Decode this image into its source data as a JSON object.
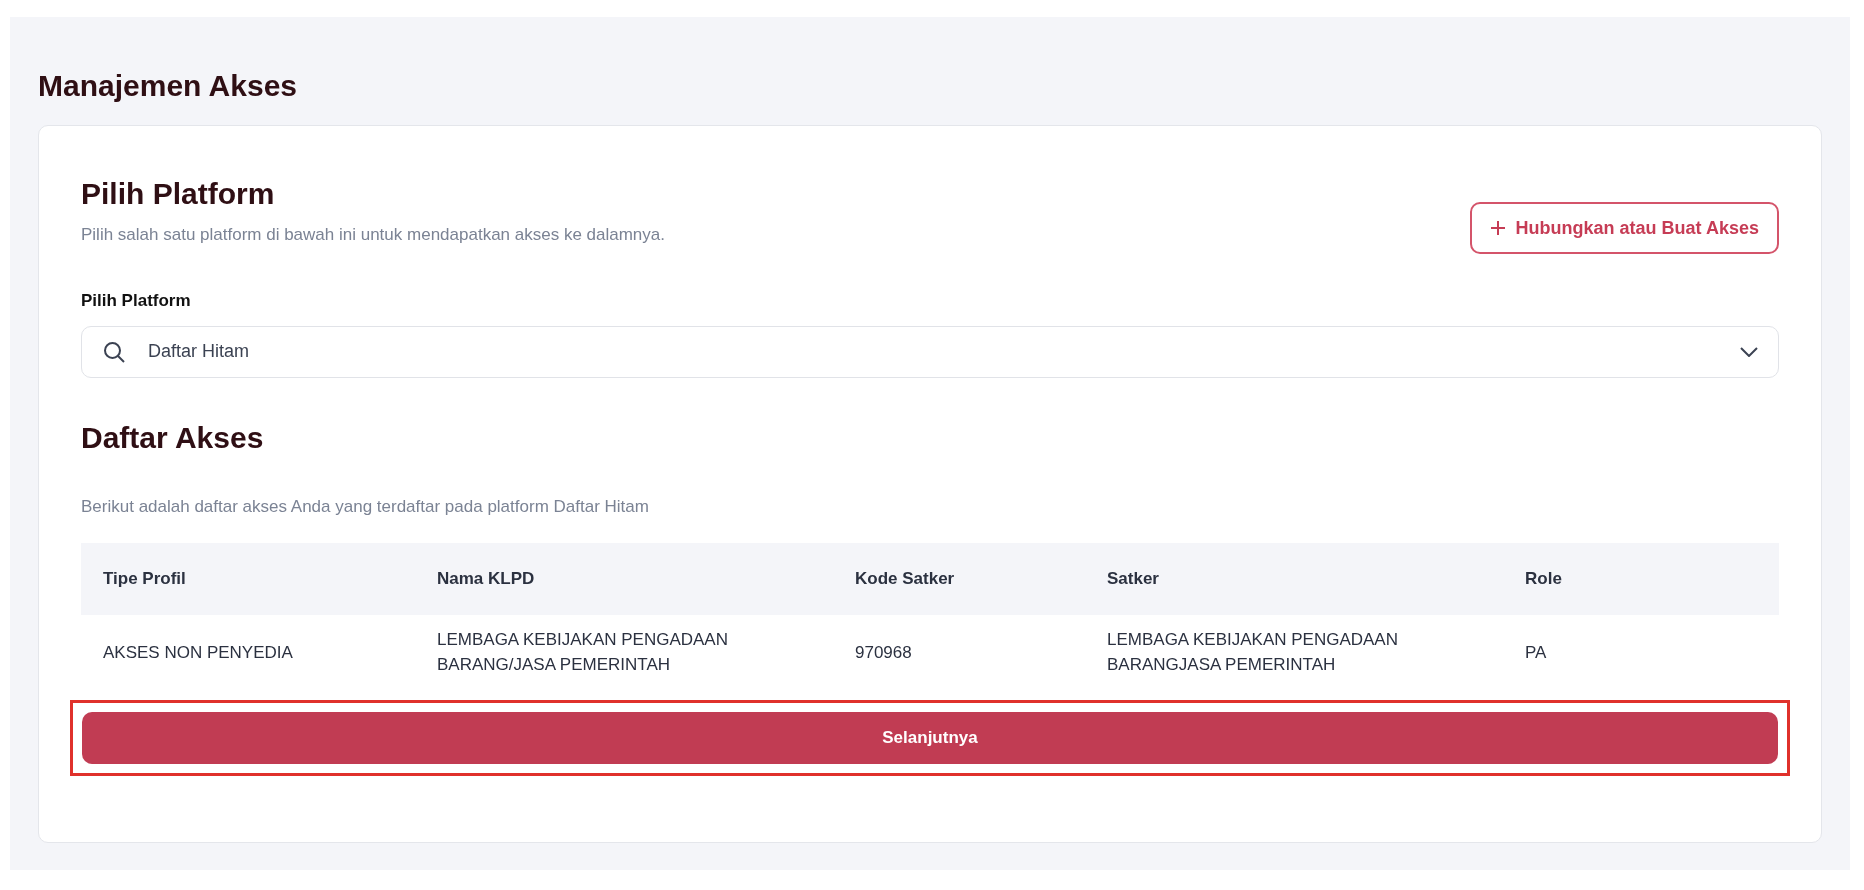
{
  "page_title": "Manajemen Akses",
  "platform_section": {
    "title": "Pilih Platform",
    "description": "Pilih salah satu platform di bawah ini untuk mendapatkan akses ke dalamnya.",
    "connect_button": "Hubungkan atau Buat Akses",
    "select_label": "Pilih Platform",
    "select_value": "Daftar Hitam"
  },
  "access_section": {
    "title": "Daftar Akses",
    "description": "Berikut adalah daftar akses Anda yang terdaftar pada platform Daftar Hitam"
  },
  "table": {
    "columns": [
      "Tipe Profil",
      "Nama KLPD",
      "Kode Satker",
      "Satker",
      "Role"
    ],
    "rows": [
      [
        "AKSES NON PENYEDIA",
        "LEMBAGA KEBIJAKAN PENGADAAN BARANG/JASA PEMERINTAH",
        "970968",
        "LEMBAGA KEBIJAKAN PENGADAAN BARANGJASA PEMERINTAH",
        "PA"
      ]
    ]
  },
  "next_button": {
    "label": "Selanjutnya",
    "highlighted": true
  }
}
